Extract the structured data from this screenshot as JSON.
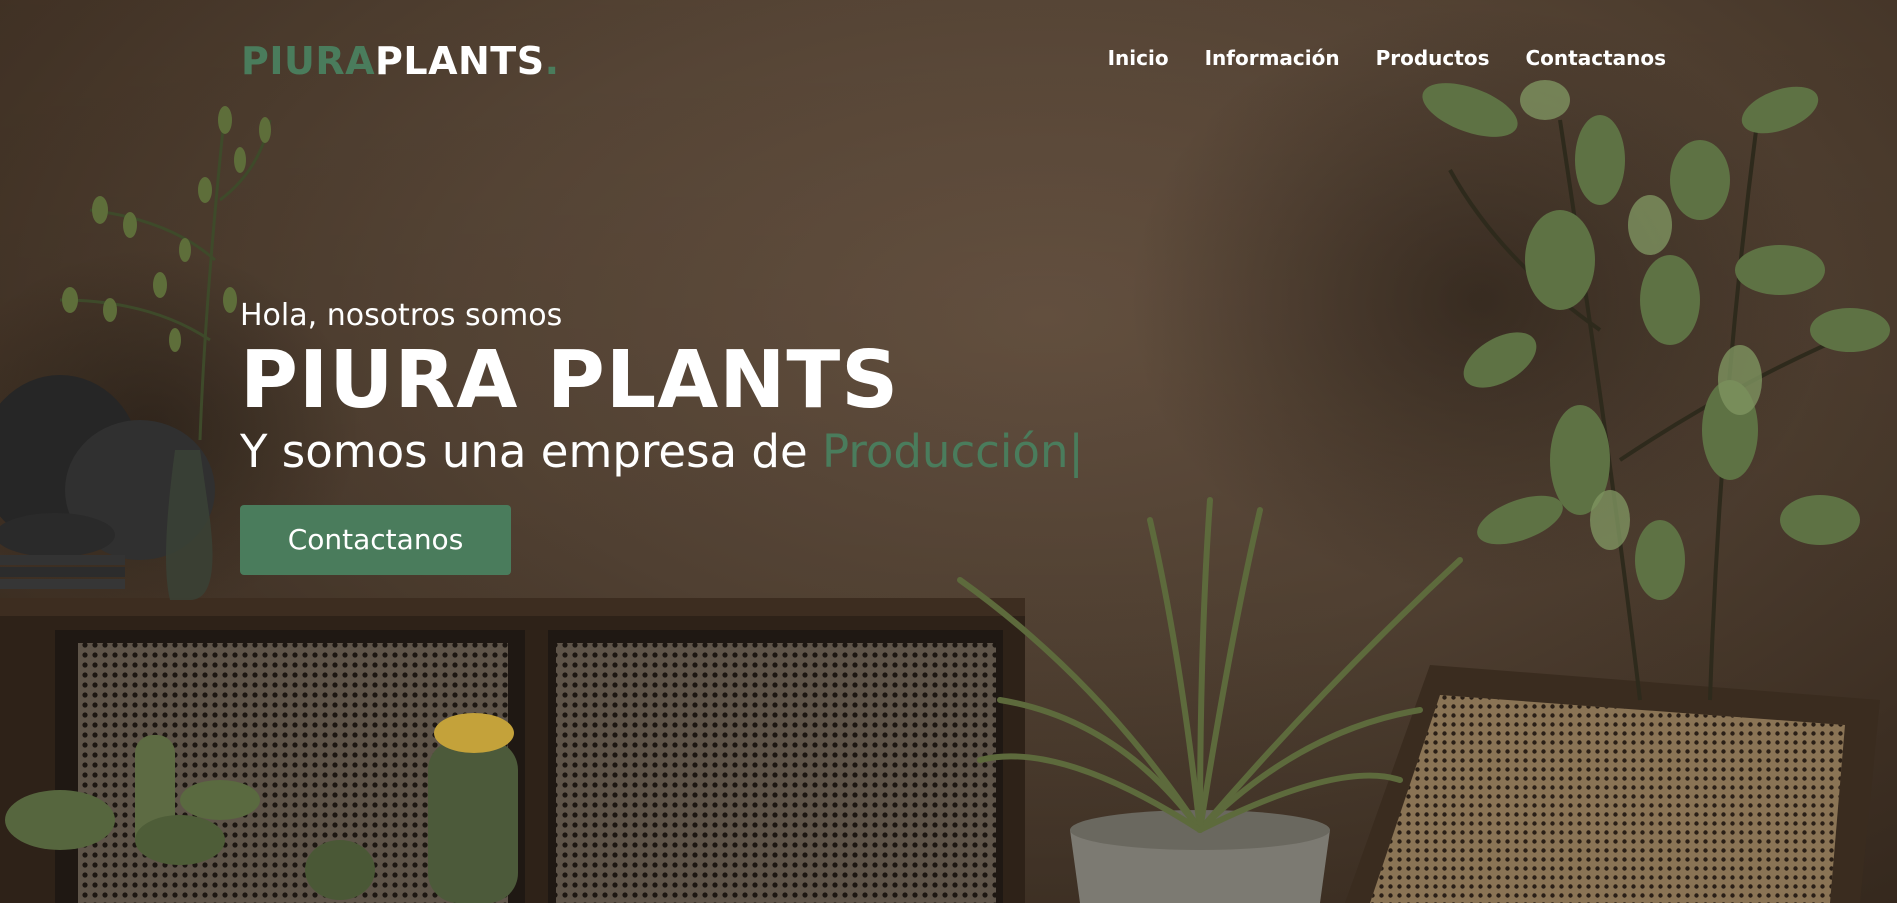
{
  "nav": {
    "logo_part1": "PIURA",
    "logo_part2": "PLANTS",
    "logo_dot": ".",
    "links": [
      "Inicio",
      "Información",
      "Productos",
      "Contactanos"
    ]
  },
  "hero": {
    "greeting": "Hola, nosotros somos",
    "title": "PIURA PLANTS",
    "tagline_prefix": "Y somos una empresa de ",
    "tagline_highlight": "Producción",
    "cursor": "|",
    "cta_label": "Contactanos"
  },
  "colors": {
    "accent": "#4a7c5c",
    "text": "#ffffff",
    "background": "#5a4838"
  }
}
